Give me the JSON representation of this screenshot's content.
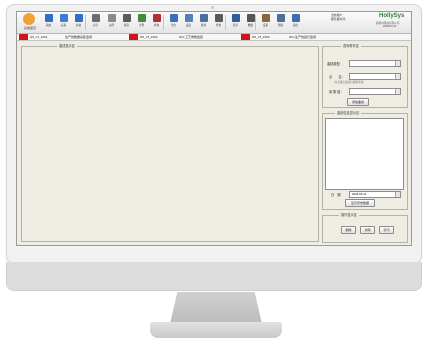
{
  "app": {
    "logo_text": "系统首页",
    "toolbar": [
      {
        "label": "系统",
        "icon": "back-arrow-icon",
        "color": "#2f6fc9"
      },
      {
        "label": "后退",
        "icon": "globe-icon",
        "color": "#3a7fd0"
      },
      {
        "label": "前进",
        "icon": "forward-arrow-icon",
        "color": "#2f6fc9"
      },
      {
        "label": "打印",
        "icon": "printer-icon",
        "color": "#6d6d6d"
      },
      {
        "label": "关闭",
        "icon": "window-icon",
        "color": "#8a8a8a"
      },
      {
        "label": "保存",
        "icon": "disk-icon",
        "color": "#5a5a5a"
      },
      {
        "label": "计算",
        "icon": "table-icon",
        "color": "#4b8a3a"
      },
      {
        "label": "查询",
        "icon": "book-icon",
        "color": "#b03030"
      },
      {
        "label": "导出",
        "icon": "grid-icon",
        "color": "#3b6fb6"
      },
      {
        "label": "设定",
        "icon": "panel-icon",
        "color": "#5a7fb8"
      },
      {
        "label": "复制",
        "icon": "copy-icon",
        "color": "#4a6fa0"
      },
      {
        "label": "查找",
        "icon": "magnifier-icon",
        "color": "#5a5a5a"
      },
      {
        "label": "显示",
        "icon": "monitor-icon",
        "color": "#2f5f9f"
      },
      {
        "label": "数据",
        "icon": "sigma-icon",
        "color": "#555555"
      },
      {
        "label": "设置",
        "icon": "gear-icon",
        "color": "#8a6a3a"
      },
      {
        "label": "帮助",
        "icon": "help-icon",
        "color": "#4a6fa0"
      },
      {
        "label": "退出",
        "icon": "user-icon",
        "color": "#3a6fb0"
      }
    ],
    "info": {
      "line1": "当前用户：",
      "line2": "服务器时间："
    },
    "brand": {
      "name": "HollySys",
      "sub": "和利时科技有限公司",
      "date": "2018-03-12"
    },
    "tabs": [
      {
        "code": "HS_LT_1001",
        "desc": "生产线数据采集监视"
      },
      {
        "code": "HS_LT_1002",
        "desc": "001-工艺参数监控"
      },
      {
        "code": "HS_LT_1003",
        "desc": "001-生产线运行监视"
      }
    ]
  },
  "main_panel": {
    "legend": "曲线显示区"
  },
  "side": {
    "query": {
      "legend": "查询条件区",
      "field1_label": "曲线类型：",
      "field2_label": "点　　名：",
      "hint": "（点名或点描述可模糊查询）",
      "field3_label": "采 集 值：",
      "button": "添加曲线"
    },
    "list": {
      "legend": "曲线信息显示区"
    },
    "time": {
      "label": "日　期",
      "value": "2018-03-12",
      "button": "显示历史数据"
    },
    "ops": {
      "legend": "操作显示区",
      "buttons": [
        "删除",
        "清除",
        "打印"
      ]
    }
  }
}
